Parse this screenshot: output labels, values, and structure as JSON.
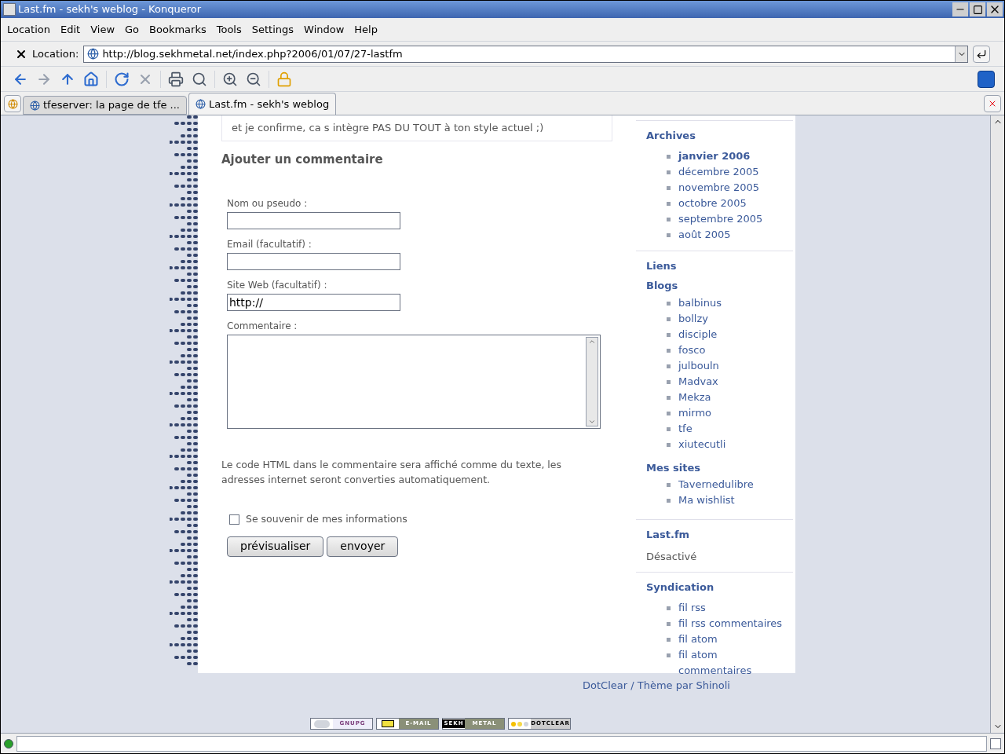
{
  "window": {
    "title": "Last.fm - sekh's weblog - Konqueror"
  },
  "menu": [
    "Location",
    "Edit",
    "View",
    "Go",
    "Bookmarks",
    "Tools",
    "Settings",
    "Window",
    "Help"
  ],
  "location": {
    "label": "Location:",
    "url": "http://blog.sekhmetal.net/index.php?2006/01/07/27-lastfm"
  },
  "tabs": [
    {
      "label": "tfeserver: la page de tfe ...",
      "selected": false
    },
    {
      "label": "Last.fm - sekh's weblog",
      "selected": true
    }
  ],
  "comment_tail": "et je confirme, ca s intègre PAS DU TOUT à ton style actuel ;)",
  "form": {
    "title": "Ajouter un commentaire",
    "fields": [
      {
        "label": "Nom ou pseudo :"
      },
      {
        "label": "Email (facultatif) :"
      },
      {
        "label": "Site Web (facultatif) :",
        "value": "http://"
      }
    ],
    "comment_label": "Commentaire :",
    "note": "Le code HTML dans le commentaire sera affiché comme du texte, les adresses internet seront converties automatiquement.",
    "remember": {
      "label": "Se souvenir de mes informations",
      "checked": false
    },
    "buttons": [
      "prévisualiser",
      "envoyer"
    ]
  },
  "sidebar": [
    {
      "kind": "list",
      "title": "Archives",
      "items": [
        {
          "label": "janvier 2006",
          "selected": true
        },
        {
          "label": "décembre 2005",
          "selected": false
        },
        {
          "label": "novembre 2005",
          "selected": false
        },
        {
          "label": "octobre 2005",
          "selected": false
        },
        {
          "label": "septembre 2005",
          "selected": false
        },
        {
          "label": "août 2005",
          "selected": false
        }
      ]
    },
    {
      "kind": "links",
      "title": "Liens",
      "groups": [
        {
          "title": "Blogs",
          "items": [
            "balbinus",
            "bollzy",
            "disciple",
            "fosco",
            "julbouln",
            "Madvax",
            "Mekza",
            "mirmo",
            "tfe",
            "xiutecutli"
          ]
        },
        {
          "title": "Mes sites",
          "items": [
            "Tavernedulibre",
            "Ma wishlist"
          ]
        }
      ]
    },
    {
      "kind": "text",
      "title": "Last.fm",
      "text": "Désactivé"
    },
    {
      "kind": "list",
      "title": "Syndication",
      "items": [
        {
          "label": "fil rss",
          "selected": false
        },
        {
          "label": "fil rss commentaires",
          "selected": false
        },
        {
          "label": "fil atom",
          "selected": false
        },
        {
          "label": "fil atom commentaires",
          "selected": false
        }
      ]
    }
  ],
  "footer": "DotClear / Thème par Shinoli",
  "badges": [
    {
      "right": "GNUPG",
      "kind": "gnupg"
    },
    {
      "right": "E-MAIL",
      "kind": "mail"
    },
    {
      "left": "SEKH",
      "right": "METAL",
      "kind": "text"
    },
    {
      "right": "DOTCLEAR",
      "kind": "dots"
    }
  ],
  "status_bar": {
    "checkbox": {
      "checked": false
    }
  }
}
